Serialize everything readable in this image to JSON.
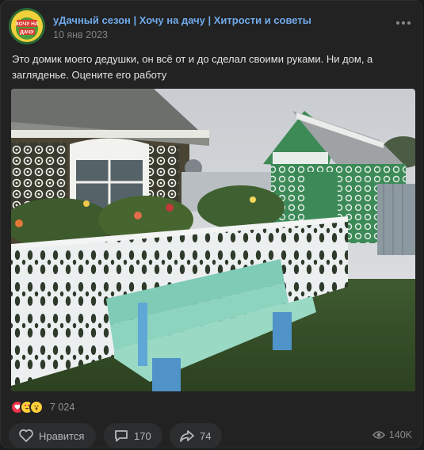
{
  "post": {
    "author": "уДачный сезон | Хочу на дачу | Хитрости и советы",
    "date": "10 янв 2023",
    "avatar_text": [
      "ХОЧУ НА",
      "ДАЧУ"
    ],
    "text": "Это домик моего дедушки, он всё от и до сделал своими руками. Ни дом, а загляденье. Оцените его работу",
    "photo_icon": "house-with-carved-fence-photo"
  },
  "reactions": {
    "icons": [
      "heart-icon",
      "heart-eyes-icon",
      "wow-icon"
    ],
    "count": "7 024"
  },
  "actions": {
    "like_label": "Нравится",
    "comments_count": "170",
    "shares_count": "74",
    "views_count": "140K"
  },
  "colors": {
    "background": "#222222",
    "link": "#71aaeb",
    "muted": "#828282"
  }
}
